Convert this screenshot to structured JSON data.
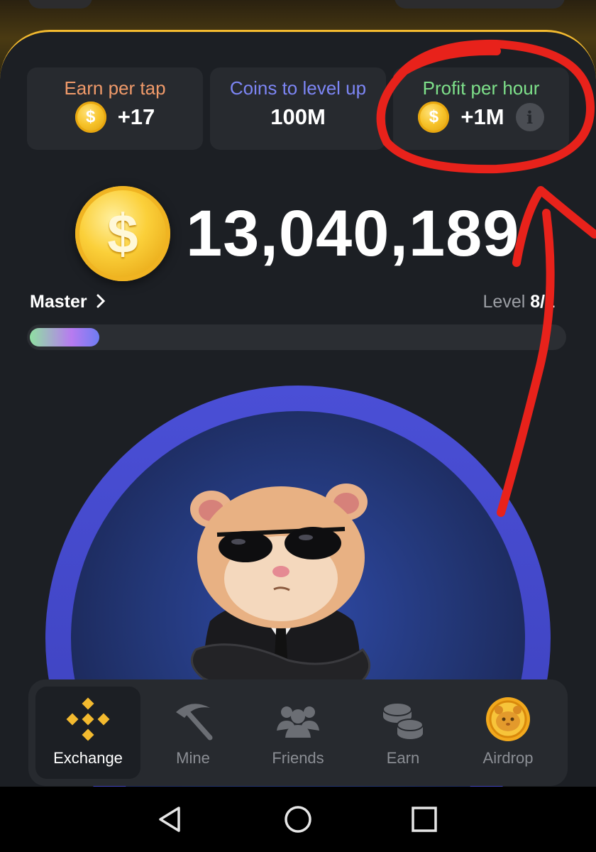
{
  "stats": [
    {
      "label": "Earn per tap",
      "value": "+17",
      "label_color": "#f09a6a"
    },
    {
      "label": "Coins to level up",
      "value": "100M",
      "label_color": "#7d86f5"
    },
    {
      "label": "Profit per hour",
      "value": "+1M",
      "label_color": "#7ee08a"
    }
  ],
  "coin_symbol": "$",
  "info_symbol": "i",
  "balance": "13,040,189",
  "rank": "Master",
  "level": {
    "prefix": "Level",
    "value": "8/1"
  },
  "progress_fraction": 0.13,
  "nav": [
    {
      "label": "Exchange",
      "icon": "binance-icon",
      "active": true
    },
    {
      "label": "Mine",
      "icon": "pickaxe-icon",
      "active": false
    },
    {
      "label": "Friends",
      "icon": "friends-icon",
      "active": false
    },
    {
      "label": "Earn",
      "icon": "coins-stack-icon",
      "active": false
    },
    {
      "label": "Airdrop",
      "icon": "hamster-coin-icon",
      "active": false
    }
  ],
  "colors": {
    "accent": "#f3ba2f",
    "panel": "#1c1f24",
    "card": "#272a2f",
    "annotation": "#e8221b",
    "circle_ring": "#4a4fd6"
  }
}
